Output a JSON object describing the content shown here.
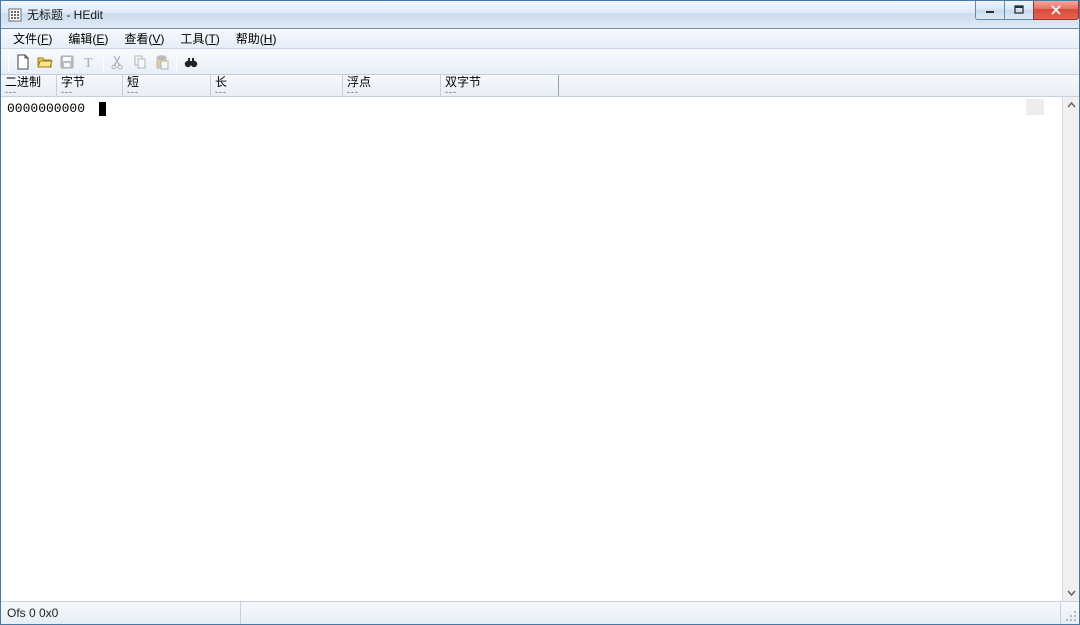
{
  "window": {
    "title": "无标题 - HEdit"
  },
  "menu": {
    "file": {
      "label": "文件",
      "accel": "F"
    },
    "edit": {
      "label": "编辑",
      "accel": "E"
    },
    "view": {
      "label": "查看",
      "accel": "V"
    },
    "tools": {
      "label": "工具",
      "accel": "T"
    },
    "help": {
      "label": "帮助",
      "accel": "H"
    }
  },
  "infobar": {
    "c0": {
      "label": "二进制",
      "value": "---"
    },
    "c1": {
      "label": "字节",
      "value": "---"
    },
    "c2": {
      "label": "短",
      "value": "---"
    },
    "c3": {
      "label": "长",
      "value": "---"
    },
    "c4": {
      "label": "浮点",
      "value": "---"
    },
    "c5": {
      "label": "双字节",
      "value": "---"
    }
  },
  "editor": {
    "offset": "0000000000"
  },
  "status": {
    "text": "Ofs 0  0x0"
  }
}
